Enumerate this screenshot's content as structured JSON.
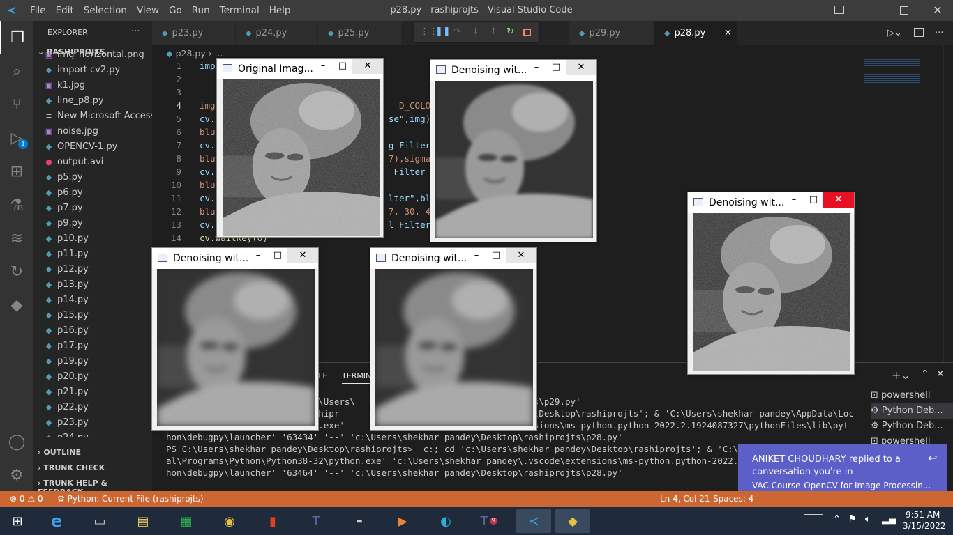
{
  "titlebar": {
    "menu": [
      "File",
      "Edit",
      "Selection",
      "View",
      "Go",
      "Run",
      "Terminal",
      "Help"
    ],
    "title": "p28.py - rashiprojts - Visual Studio Code"
  },
  "activity": {
    "debug_badge": "1"
  },
  "explorer": {
    "header": "EXPLORER",
    "more": "···",
    "folder": "RASHIPROJTS",
    "files": [
      {
        "name": "img_horizontal.png",
        "icon": "image-icon",
        "color": "#b180d7"
      },
      {
        "name": "import cv2.py",
        "icon": "python-icon",
        "color": "#519aba"
      },
      {
        "name": "k1.jpg",
        "icon": "image-icon",
        "color": "#b180d7"
      },
      {
        "name": "line_p8.py",
        "icon": "python-icon",
        "color": "#519aba"
      },
      {
        "name": "New Microsoft Access...",
        "icon": "file-icon",
        "color": "#ccc"
      },
      {
        "name": "noise.jpg",
        "icon": "image-icon",
        "color": "#b180d7"
      },
      {
        "name": "OPENCV-1.py",
        "icon": "python-icon",
        "color": "#519aba"
      },
      {
        "name": "output.avi",
        "icon": "video-icon",
        "color": "#e04070"
      },
      {
        "name": "p5.py",
        "icon": "python-icon",
        "color": "#519aba"
      },
      {
        "name": "p6.py",
        "icon": "python-icon",
        "color": "#519aba"
      },
      {
        "name": "p7.py",
        "icon": "python-icon",
        "color": "#519aba"
      },
      {
        "name": "p9.py",
        "icon": "python-icon",
        "color": "#519aba"
      },
      {
        "name": "p10.py",
        "icon": "python-icon",
        "color": "#519aba"
      },
      {
        "name": "p11.py",
        "icon": "python-icon",
        "color": "#519aba"
      },
      {
        "name": "p12.py",
        "icon": "python-icon",
        "color": "#519aba"
      },
      {
        "name": "p13.py",
        "icon": "python-icon",
        "color": "#519aba"
      },
      {
        "name": "p14.py",
        "icon": "python-icon",
        "color": "#519aba"
      },
      {
        "name": "p15.py",
        "icon": "python-icon",
        "color": "#519aba"
      },
      {
        "name": "p16.py",
        "icon": "python-icon",
        "color": "#519aba"
      },
      {
        "name": "p17.py",
        "icon": "python-icon",
        "color": "#519aba"
      },
      {
        "name": "p19.py",
        "icon": "python-icon",
        "color": "#519aba"
      },
      {
        "name": "p20.py",
        "icon": "python-icon",
        "color": "#519aba"
      },
      {
        "name": "p21.py",
        "icon": "python-icon",
        "color": "#519aba"
      },
      {
        "name": "p22.py",
        "icon": "python-icon",
        "color": "#519aba"
      },
      {
        "name": "p23.py",
        "icon": "python-icon",
        "color": "#519aba"
      },
      {
        "name": "p24.py",
        "icon": "python-icon",
        "color": "#519aba"
      }
    ],
    "sections": [
      "OUTLINE",
      "TRUNK CHECK",
      "TRUNK HELP & FEEDBACK"
    ]
  },
  "tabs": [
    {
      "label": "p23.py"
    },
    {
      "label": "p24.py"
    },
    {
      "label": "p25.py"
    },
    {
      "label": "p29.py"
    },
    {
      "label": "p28.py",
      "active": true
    }
  ],
  "breadcrumb": {
    "file": "p28.py",
    "rest": "..."
  },
  "code": [
    {
      "n": "1",
      "t": "imp"
    },
    {
      "n": "2",
      "t": ""
    },
    {
      "n": "3",
      "t": ""
    },
    {
      "n": "4",
      "t": "img                                   D_COLOR)"
    },
    {
      "n": "5",
      "t": "cv.                                 se\",img)"
    },
    {
      "n": "6",
      "t": "blu"
    },
    {
      "n": "7",
      "t": "cv.                                 g Filter\""
    },
    {
      "n": "8",
      "t": "blu                                 7),sigmaX"
    },
    {
      "n": "9",
      "t": "cv.                                  Filter K"
    },
    {
      "n": "10",
      "t": "blu"
    },
    {
      "n": "11",
      "t": "cv.                                 lter\",blu"
    },
    {
      "n": "12",
      "t": "blu                                 7, 30, 41"
    },
    {
      "n": "13",
      "t": "cv.                                 l Filter\""
    },
    {
      "n": "14",
      "t": "cv.waitKey(0)"
    }
  ],
  "panel": {
    "tabs": [
      "LE",
      "TERMINAL"
    ],
    "lines": [
      "                      --' 'c:\\Users\\                               ojts\\p29.py'",
      "                      top\\rashipr                               pandey\\Desktop\\rashiprojts'; & 'C:\\Users\\shekhar pandey\\AppData\\Loc",
      "                      \\python.exe'                               extensions\\ms-python.python-2022.2.1924087327\\pythonFiles\\lib\\pyt",
      "hon\\debugpy\\launcher' '63434' '--' 'c:\\Users\\shekhar pandey\\Desktop\\rashiprojts\\p28.py'",
      "PS C:\\Users\\shekhar pandey\\Desktop\\rashiprojts>  c:; cd 'c:\\Users\\shekhar pandey\\Desktop\\rashiprojts'; & 'C:\\Users\\sh",
      "al\\Programs\\Python\\Python38-32\\python.exe' 'c:\\Users\\shekhar pandey\\.vscode\\extensions\\ms-python.python-2022.2.192408",
      "hon\\debugpy\\launcher' '63464' '--' 'c:\\Users\\shekhar pandey\\Desktop\\rashiprojts\\p28.py'"
    ],
    "terminals": [
      "powershell",
      "Python Deb...",
      "Python Deb...",
      "powershell"
    ]
  },
  "cv_windows": [
    {
      "title": "Original Imag...",
      "blur": "none",
      "noise": true
    },
    {
      "title": "Denoising wit...",
      "blur": "soft",
      "noise": false
    },
    {
      "title": "Denoising wit...",
      "blur": "heavy",
      "noise": false
    },
    {
      "title": "Denoising wit...",
      "blur": "heavy",
      "noise": false
    },
    {
      "title": "Denoising wit...",
      "blur": "none",
      "noise": true
    }
  ],
  "statusbar": {
    "errors": "0",
    "warnings": "0",
    "run": "Python: Current File (rashiprojts)",
    "position": "Ln 4, Col 21",
    "spaces": "Spaces: 4"
  },
  "notification": {
    "line1": "ANIKET CHOUDHARY replied to a",
    "line2": "conversation you're in",
    "line3": "VAC Course-OpenCV for Image Processin..."
  },
  "taskbar": {
    "time": "9:51 AM",
    "date": "3/15/2022",
    "teams_badge": "9"
  }
}
